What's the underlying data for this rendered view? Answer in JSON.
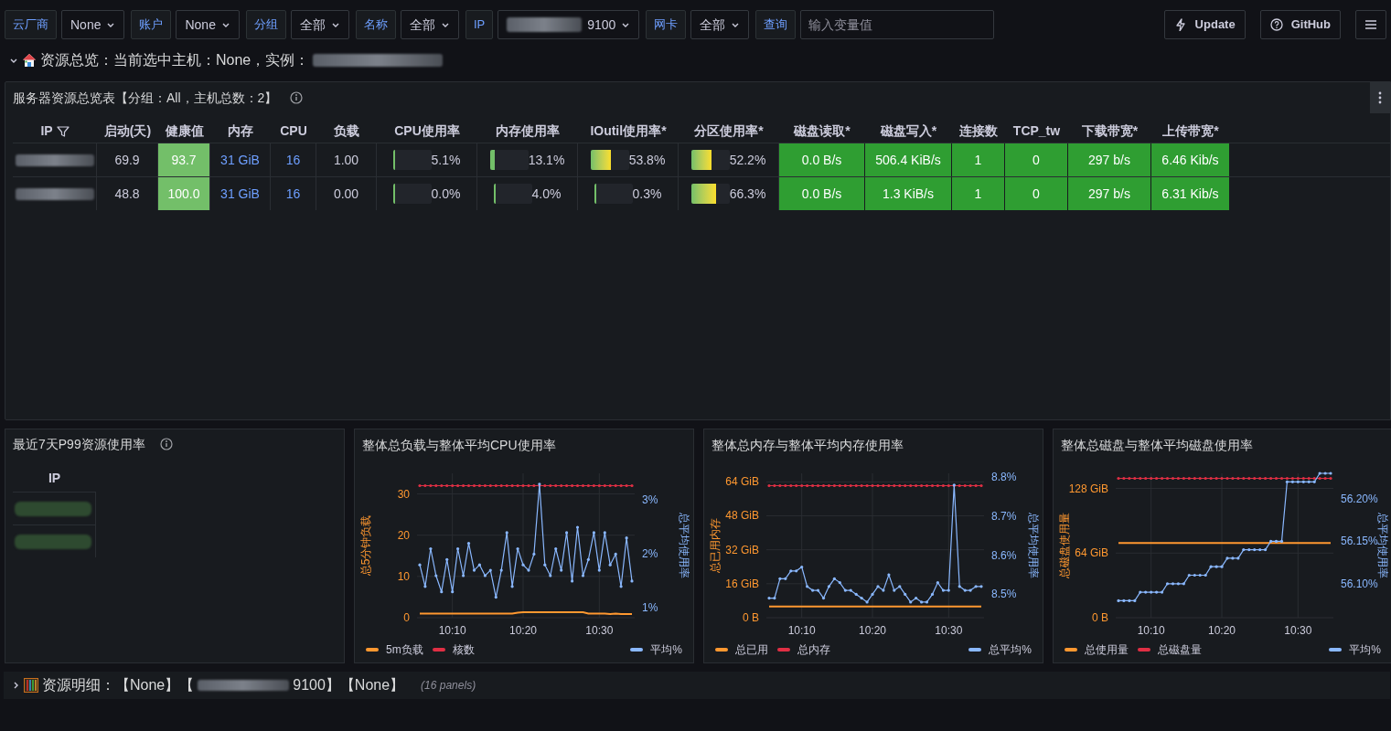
{
  "filters": [
    {
      "label": "云厂商",
      "kind": "select",
      "value": "None"
    },
    {
      "label": "账户",
      "kind": "select",
      "value": "None"
    },
    {
      "label": "分组",
      "kind": "select",
      "value": "全部"
    },
    {
      "label": "名称",
      "kind": "select",
      "value": "全部"
    },
    {
      "label": "IP",
      "kind": "select",
      "value": "9100",
      "redacted": true
    },
    {
      "label": "网卡",
      "kind": "select",
      "value": "全部"
    },
    {
      "label": "查询",
      "kind": "input",
      "placeholder": "输入变量值"
    }
  ],
  "toolbar_buttons": [
    {
      "label": "Update",
      "kind": "bolt"
    },
    {
      "label": "GitHub",
      "kind": "help"
    }
  ],
  "overview_row": {
    "expanded": true,
    "title": "资源总览：当前选中主机：None，实例："
  },
  "summary_panel": {
    "title": "服务器资源总览表【分组：All，主机总数：2】",
    "columns": [
      {
        "label": "IP",
        "kind": "redacted"
      },
      {
        "label": "启动(天)",
        "kind": "plain"
      },
      {
        "label": "健康值",
        "kind": "health"
      },
      {
        "label": "内存",
        "kind": "link"
      },
      {
        "label": "CPU",
        "kind": "link"
      },
      {
        "label": "负载",
        "kind": "plain"
      },
      {
        "label": "CPU使用率",
        "kind": "gauge"
      },
      {
        "label": "内存使用率",
        "kind": "gauge"
      },
      {
        "label": "IOutil使用率*",
        "kind": "gauge"
      },
      {
        "label": "分区使用率*",
        "kind": "gauge"
      },
      {
        "label": "磁盘读取*",
        "kind": "green"
      },
      {
        "label": "磁盘写入*",
        "kind": "green"
      },
      {
        "label": "连接数",
        "kind": "green"
      },
      {
        "label": "TCP_tw",
        "kind": "green"
      },
      {
        "label": "下载带宽*",
        "kind": "green"
      },
      {
        "label": "上传带宽*",
        "kind": "green"
      }
    ],
    "rows": [
      {
        "cells": [
          "",
          {
            "text": "69.9"
          },
          {
            "text": "93.7"
          },
          {
            "text": "31 GiB"
          },
          {
            "text": "16"
          },
          {
            "text": "1.00"
          },
          {
            "text": "5.1%",
            "level": 0.051
          },
          {
            "text": "13.1%",
            "level": 0.131
          },
          {
            "text": "53.8%",
            "level": 0.538
          },
          {
            "text": "52.2%",
            "level": 0.522
          },
          {
            "text": "0.0 B/s"
          },
          {
            "text": "506.4 KiB/s"
          },
          {
            "text": "1"
          },
          {
            "text": "0"
          },
          {
            "text": "297 b/s"
          },
          {
            "text": "6.46 Kib/s"
          }
        ]
      },
      {
        "cells": [
          "",
          {
            "text": "48.8"
          },
          {
            "text": "100.0"
          },
          {
            "text": "31 GiB"
          },
          {
            "text": "16"
          },
          {
            "text": "0.00"
          },
          {
            "text": "0.0%",
            "level": 0.0
          },
          {
            "text": "4.0%",
            "level": 0.04
          },
          {
            "text": "0.3%",
            "level": 0.003
          },
          {
            "text": "66.3%",
            "level": 0.663
          },
          {
            "text": "0.0 B/s"
          },
          {
            "text": "1.3 KiB/s"
          },
          {
            "text": "1"
          },
          {
            "text": "0"
          },
          {
            "text": "297 b/s"
          },
          {
            "text": "6.31 Kib/s"
          }
        ]
      }
    ]
  },
  "p99_panel": {
    "title": "最近7天P99资源使用率",
    "column": "IP"
  },
  "chart_panels": [
    {
      "title": "整体总负载与整体平均CPU使用率",
      "chart_data": {
        "type": "line",
        "grid": true,
        "ylabel": "总5分钟负载",
        "y2label": "总平均使用率",
        "categories": [
          null,
          null,
          null,
          null,
          null,
          null,
          "10:10",
          null,
          null,
          null,
          null,
          null,
          null,
          null,
          null,
          null,
          null,
          null,
          null,
          "10:20",
          null,
          null,
          null,
          null,
          null,
          null,
          null,
          null,
          null,
          null,
          null,
          null,
          null,
          "10:30",
          null,
          null,
          null,
          null,
          null,
          null
        ],
        "ylim": [
          0,
          35
        ],
        "yticks": [
          0,
          10,
          20,
          30
        ],
        "y2lim": [
          0.82,
          3.5
        ],
        "y2ticks": [
          {
            "value": 1,
            "label": "1%"
          },
          {
            "value": 2,
            "label": "2%"
          },
          {
            "value": 3,
            "label": "3%"
          }
        ],
        "series": [
          {
            "name": "5m负载",
            "color": "#ff9830",
            "values": [
              1.0,
              1.0,
              1.0,
              1.0,
              1.0,
              1.0,
              1.0,
              1.0,
              1.0,
              1.0,
              1.0,
              1.0,
              1.0,
              1.0,
              1.0,
              1.0,
              1.0,
              1.0,
              1.2,
              1.3,
              1.3,
              1.3,
              1.3,
              1.3,
              1.3,
              1.3,
              1.3,
              1.3,
              1.3,
              1.3,
              1.3,
              1.0,
              1.0,
              1.0,
              1.0,
              0.9,
              1.0,
              0.9,
              0.9,
              0.9
            ]
          },
          {
            "name": "核数",
            "color": "#e02f44",
            "values": [
              32,
              32,
              32,
              32,
              32,
              32,
              32,
              32,
              32,
              32,
              32,
              32,
              32,
              32,
              32,
              32,
              32,
              32,
              32,
              32,
              32,
              32,
              32,
              32,
              32,
              32,
              32,
              32,
              32,
              32,
              32,
              32,
              32,
              32,
              32,
              32,
              32,
              32,
              32,
              32
            ]
          },
          {
            "name": "平均%",
            "color": "#8ab8ff",
            "axis": "y2",
            "values": [
              1.8,
              1.4,
              2.1,
              1.6,
              1.3,
              1.9,
              1.3,
              2.1,
              1.6,
              2.2,
              1.7,
              1.8,
              1.6,
              1.7,
              1.2,
              1.7,
              2.4,
              1.4,
              2.1,
              1.8,
              1.7,
              2.0,
              3.3,
              1.8,
              1.6,
              2.1,
              1.7,
              2.4,
              1.5,
              2.5,
              1.6,
              1.9,
              2.4,
              1.7,
              2.4,
              1.8,
              2.0,
              1.4,
              2.3,
              1.5
            ]
          }
        ]
      }
    },
    {
      "title": "整体总内存与整体平均内存使用率",
      "chart_data": {
        "type": "line",
        "grid": true,
        "ylabel": "总已用内存",
        "y2label": "总平均使用率",
        "categories": [
          null,
          null,
          null,
          null,
          null,
          null,
          "10:10",
          null,
          null,
          null,
          null,
          null,
          null,
          null,
          null,
          null,
          null,
          null,
          null,
          "10:20",
          null,
          null,
          null,
          null,
          null,
          null,
          null,
          null,
          null,
          null,
          null,
          null,
          null,
          "10:30",
          null,
          null,
          null,
          null,
          null,
          null
        ],
        "ylim": [
          0,
          68
        ],
        "yticks": [
          {
            "value": 0,
            "label": "0 B"
          },
          {
            "value": 16,
            "label": "16 GiB"
          },
          {
            "value": 32,
            "label": "32 GiB"
          },
          {
            "value": 48,
            "label": "48 GiB"
          },
          {
            "value": 64,
            "label": "64 GiB"
          }
        ],
        "y2lim": [
          8.44,
          8.81
        ],
        "y2ticks": [
          {
            "value": 8.5,
            "label": "8.5%"
          },
          {
            "value": 8.6,
            "label": "8.6%"
          },
          {
            "value": 8.7,
            "label": "8.7%"
          },
          {
            "value": 8.8,
            "label": "8.8%"
          }
        ],
        "series": [
          {
            "name": "总已用",
            "color": "#ff9830",
            "values": [
              5.3,
              5.3,
              5.3,
              5.3,
              5.3,
              5.3,
              5.3,
              5.3,
              5.3,
              5.3,
              5.3,
              5.3,
              5.3,
              5.3,
              5.3,
              5.3,
              5.3,
              5.3,
              5.3,
              5.3,
              5.3,
              5.3,
              5.3,
              5.3,
              5.3,
              5.3,
              5.3,
              5.3,
              5.3,
              5.3,
              5.3,
              5.3,
              5.3,
              5.3,
              5.3,
              5.3,
              5.3,
              5.3,
              5.3,
              5.3
            ]
          },
          {
            "name": "总内存",
            "color": "#e02f44",
            "values": [
              62.2,
              62.2,
              62.2,
              62.2,
              62.2,
              62.2,
              62.2,
              62.2,
              62.2,
              62.2,
              62.2,
              62.2,
              62.2,
              62.2,
              62.2,
              62.2,
              62.2,
              62.2,
              62.2,
              62.2,
              62.2,
              62.2,
              62.2,
              62.2,
              62.2,
              62.2,
              62.2,
              62.2,
              62.2,
              62.2,
              62.2,
              62.2,
              62.2,
              62.2,
              62.2,
              62.2,
              62.2,
              62.2,
              62.2,
              62.2
            ]
          },
          {
            "name": "总平均%",
            "color": "#8ab8ff",
            "axis": "y2",
            "values": [
              8.49,
              8.49,
              8.54,
              8.54,
              8.56,
              8.56,
              8.57,
              8.52,
              8.51,
              8.51,
              8.49,
              8.52,
              8.54,
              8.53,
              8.51,
              8.51,
              8.5,
              8.49,
              8.48,
              8.5,
              8.52,
              8.51,
              8.55,
              8.51,
              8.52,
              8.5,
              8.48,
              8.49,
              8.48,
              8.48,
              8.5,
              8.53,
              8.51,
              8.51,
              8.78,
              8.52,
              8.51,
              8.51,
              8.52,
              8.52
            ]
          }
        ]
      }
    },
    {
      "title": "整体总磁盘与整体平均磁盘使用率",
      "chart_data": {
        "type": "line",
        "grid": true,
        "ylabel": "总磁盘使用量",
        "y2label": "总平均使用率",
        "categories": [
          null,
          null,
          null,
          null,
          null,
          null,
          "10:10",
          null,
          null,
          null,
          null,
          null,
          null,
          null,
          null,
          null,
          null,
          null,
          null,
          "10:20",
          null,
          null,
          null,
          null,
          null,
          null,
          null,
          null,
          null,
          null,
          null,
          null,
          null,
          "10:30",
          null,
          null,
          null,
          null,
          null,
          null
        ],
        "ylim": [
          0,
          143
        ],
        "yticks": [
          {
            "value": 0,
            "label": "0 B"
          },
          {
            "value": 64,
            "label": "64 GiB"
          },
          {
            "value": 128,
            "label": "128 GiB"
          }
        ],
        "y2lim": [
          56.06,
          56.23
        ],
        "y2ticks": [
          {
            "value": 56.1,
            "label": "56.10%"
          },
          {
            "value": 56.15,
            "label": "56.15%"
          },
          {
            "value": 56.2,
            "label": "56.20%"
          }
        ],
        "series": [
          {
            "name": "总使用量",
            "color": "#ff9830",
            "values": [
              74,
              74,
              74,
              74,
              74,
              74,
              74,
              74,
              74,
              74,
              74,
              74,
              74,
              74,
              74,
              74,
              74,
              74,
              74,
              74,
              74,
              74,
              74,
              74,
              74,
              74,
              74,
              74,
              74,
              74,
              74,
              74,
              74,
              74,
              74,
              74,
              74,
              74,
              74,
              74
            ]
          },
          {
            "name": "总磁盘量",
            "color": "#e02f44",
            "values": [
              138,
              138,
              138,
              138,
              138,
              138,
              138,
              138,
              138,
              138,
              138,
              138,
              138,
              138,
              138,
              138,
              138,
              138,
              138,
              138,
              138,
              138,
              138,
              138,
              138,
              138,
              138,
              138,
              138,
              138,
              138,
              138,
              138,
              138,
              138,
              138,
              138,
              138,
              138,
              138
            ]
          },
          {
            "name": "平均%",
            "color": "#8ab8ff",
            "axis": "y2",
            "values": [
              56.08,
              56.08,
              56.08,
              56.08,
              56.09,
              56.09,
              56.09,
              56.09,
              56.09,
              56.1,
              56.1,
              56.1,
              56.1,
              56.11,
              56.11,
              56.11,
              56.11,
              56.12,
              56.12,
              56.12,
              56.13,
              56.13,
              56.13,
              56.14,
              56.14,
              56.14,
              56.14,
              56.14,
              56.15,
              56.15,
              56.15,
              56.22,
              56.22,
              56.22,
              56.22,
              56.22,
              56.22,
              56.23,
              56.23,
              56.23
            ]
          }
        ]
      }
    }
  ],
  "details_row": {
    "expanded": false,
    "title_start": "资源明细：【None】【",
    "title_end": "9100】【None】",
    "panel_count": "(16 panels)"
  }
}
